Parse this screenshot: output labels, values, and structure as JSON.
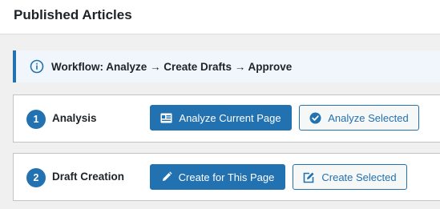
{
  "page": {
    "title": "Published Articles"
  },
  "notice": {
    "text": "Workflow: Analyze → Create Drafts → Approve",
    "icon": "info-icon"
  },
  "steps": [
    {
      "number": "1",
      "label": "Analysis",
      "primary": {
        "label": "Analyze Current Page",
        "icon": "id-card-icon"
      },
      "secondary": {
        "label": "Analyze Selected",
        "icon": "check-circle-icon"
      }
    },
    {
      "number": "2",
      "label": "Draft Creation",
      "primary": {
        "label": "Create for This Page",
        "icon": "pencil-icon"
      },
      "secondary": {
        "label": "Create Selected",
        "icon": "edit-icon"
      }
    }
  ],
  "colors": {
    "accent": "#2271b1",
    "background": "#f0f0f1",
    "notice_background": "#f0f6fc",
    "text": "#1d2327"
  }
}
